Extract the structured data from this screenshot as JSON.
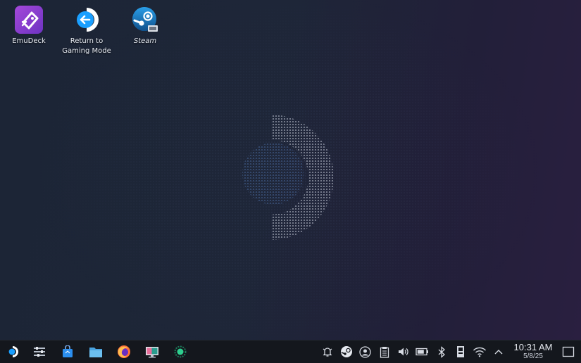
{
  "desktop": {
    "icons": [
      {
        "label": "EmuDeck",
        "icon": "emudeck-icon"
      },
      {
        "label": "Return to\nGaming Mode",
        "icon": "return-arrow-icon"
      },
      {
        "label": "Steam",
        "icon": "steam-icon"
      }
    ]
  },
  "taskbar": {
    "launchers": [
      {
        "icon": "steamos-start-icon"
      },
      {
        "icon": "system-settings-icon"
      },
      {
        "icon": "discover-store-icon"
      },
      {
        "icon": "dolphin-file-manager-icon"
      },
      {
        "icon": "firefox-icon"
      },
      {
        "icon": "remote-desktop-icon"
      },
      {
        "icon": "green-circle-app-icon"
      }
    ],
    "tray": [
      {
        "icon": "notifications-bell-icon"
      },
      {
        "icon": "steam-tray-icon"
      },
      {
        "icon": "discord-icon"
      },
      {
        "icon": "clipboard-icon"
      },
      {
        "icon": "volume-icon"
      },
      {
        "icon": "battery-icon"
      },
      {
        "icon": "bluetooth-icon"
      },
      {
        "icon": "device-icon"
      },
      {
        "icon": "wifi-icon"
      },
      {
        "icon": "expand-tray-icon"
      }
    ],
    "clock": {
      "time": "10:31 AM",
      "date": "5/8/25"
    }
  },
  "colors": {
    "taskbar_bg": "#14171d",
    "desktop_bg": "#1e2638",
    "steam_blue": "#1a9fff",
    "emudeck_purple": "#8a3fd1"
  }
}
